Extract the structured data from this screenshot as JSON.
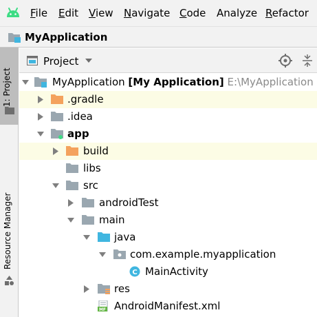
{
  "menu": {
    "items": [
      "File",
      "Edit",
      "View",
      "Navigate",
      "Code",
      "Analyze",
      "Refactor"
    ],
    "mnemonics": [
      "F",
      "E",
      "V",
      "N",
      "C",
      "",
      "R"
    ]
  },
  "navbar": {
    "title": "MyApplication"
  },
  "toolstrip": {
    "project_label": "1: Project",
    "resource_label": "Resource Manager"
  },
  "panel": {
    "title": "Project"
  },
  "tree": {
    "root_name": "MyApplication",
    "root_module": "[My Application]",
    "root_path": "E:\\MyApplication",
    "items": [
      {
        "label": ".gradle"
      },
      {
        "label": ".idea"
      },
      {
        "label": "app"
      },
      {
        "label": "build"
      },
      {
        "label": "libs"
      },
      {
        "label": "src"
      },
      {
        "label": "androidTest"
      },
      {
        "label": "main"
      },
      {
        "label": "java"
      },
      {
        "label": "com.example.myapplication"
      },
      {
        "label": "MainActivity"
      },
      {
        "label": "res"
      },
      {
        "label": "AndroidManifest.xml"
      }
    ]
  },
  "colors": {
    "android_green": "#3ddc84",
    "folder_gray": "#9aa7b0",
    "folder_orange": "#f4a25d",
    "folder_blue": "#40b6e0",
    "class_icon": "#40b6e0",
    "highlight_row": "#fcfce5"
  }
}
